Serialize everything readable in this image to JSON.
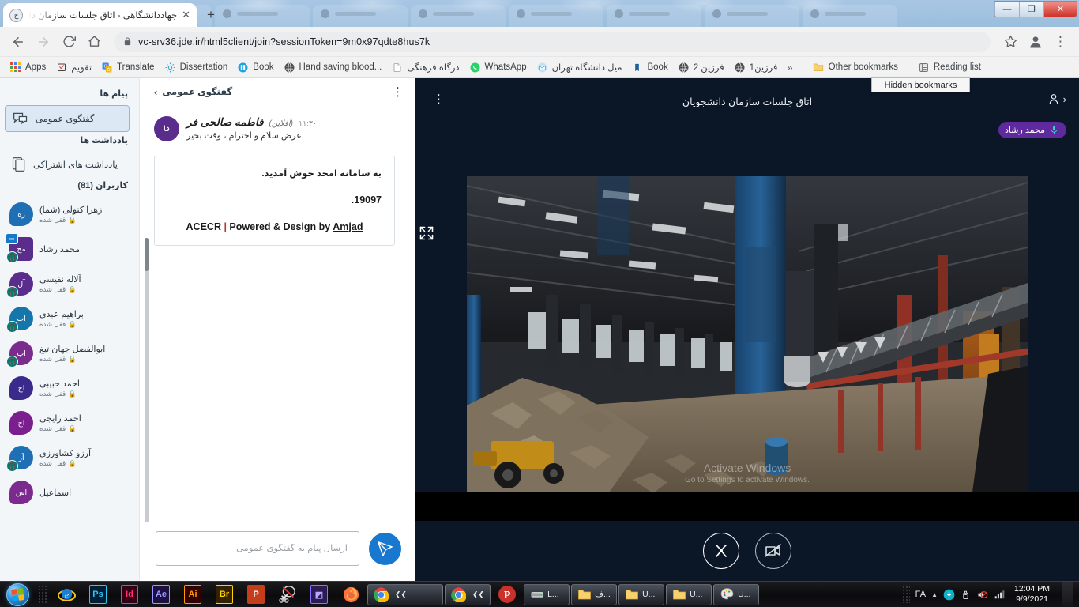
{
  "browser": {
    "tab": {
      "title": "جهاددانشگاهی - اتاق جلسات سازمان دانشج",
      "close_label": "✕",
      "favicon_label": "ج"
    },
    "new_tab_label": "+",
    "window_controls": {
      "minimize": "—",
      "maximize": "❐",
      "close": "✕"
    },
    "toolbar": {
      "back_label": "←",
      "forward_label": "→",
      "reload_label": "⟳",
      "home_label": "⌂",
      "lock_label": "🔒",
      "url_host": "vc-srv36.jde.ir",
      "url_path": "/html5client/join?sessionToken=9m0x97qdte8hus7k",
      "url_full": "vc-srv36.jde.ir/html5client/join?sessionToken=9m0x97qdte8hus7k",
      "star_label": "☆",
      "profile_label": "profile",
      "menu_label": "⋮"
    },
    "bookmarks": [
      {
        "label": "Apps",
        "icon": "apps-grid-icon"
      },
      {
        "label": "تقویم",
        "icon": "calendar-check-icon",
        "rtl": true
      },
      {
        "label": "Translate",
        "icon": "google-translate-icon"
      },
      {
        "label": "Dissertation",
        "icon": "gear-icon"
      },
      {
        "label": "Book",
        "icon": "book-globe-icon"
      },
      {
        "label": "Hand saving blood...",
        "icon": "globe-icon"
      },
      {
        "label": "درگاه فرهنگی",
        "icon": "document-icon",
        "rtl": true
      },
      {
        "label": "WhatsApp",
        "icon": "whatsapp-icon"
      },
      {
        "label": "میل دانشگاه تهران",
        "icon": "mail-icon",
        "rtl": true
      },
      {
        "label": "Book",
        "icon": "book-icon"
      },
      {
        "label": "فرزین 2",
        "icon": "globe-icon",
        "rtl": true
      },
      {
        "label": "فرزین1",
        "icon": "globe-icon",
        "rtl": true
      }
    ],
    "overflow_label": "»",
    "other_bookmarks": "Other bookmarks",
    "reading_list": "Reading list",
    "tooltip": "Hidden bookmarks"
  },
  "meeting": {
    "menu_label": "⋮",
    "title": "اتاق جلسات سازمان دانشجویان",
    "user_icon_label": "user-icon",
    "collapse_label": "‹",
    "active_talker": {
      "name": "محمد رشاد",
      "mic_icon": "microphone-icon"
    },
    "expand_icon": "expand-icon",
    "watermark": {
      "line1": "Activate Windows",
      "line2": "Go to Settings to activate Windows."
    },
    "controls": [
      {
        "name": "camera-off-button",
        "icon": "camera-off-icon"
      },
      {
        "name": "screen-share-button",
        "icon": "screen-share-icon"
      }
    ]
  },
  "chat": {
    "menu_label": "⋮",
    "title": "گفتگوی عمومی",
    "back_label": "›",
    "message": {
      "avatar_initials": "فا",
      "author": "فاطمه صالحی فر",
      "offline": "(آفلاین)",
      "time": "۱۱:۳۰",
      "text": "عرض سلام و احترام ، وقت بخیر"
    },
    "welcome": {
      "line1": "به سامانه امجد خوش آمدید.",
      "line2": ".19097",
      "line3_prefix": "ACECR ",
      "line3_bar": "|",
      "line3_mid": " Powered & Design by ",
      "line3_link": "Amjad"
    },
    "input_placeholder": "ارسال پیام به گفتگوی عمومی",
    "input_value": "",
    "send_label": "send-icon"
  },
  "sidebar": {
    "messages_header": "پیام ها",
    "chat_item": {
      "label": "گفتگوی عمومی",
      "icon": "chat-bubbles-icon"
    },
    "notes_header": "یادداشت ها",
    "notes_item": {
      "label": "یادداشت های اشتراکی",
      "icon": "notes-icon"
    },
    "users_header": "کاربران (81)",
    "users": [
      {
        "initials": "زه",
        "name": "زهرا کتولی (شما)",
        "status": "قفل شده",
        "color": "#1f6fb5",
        "shape": "round",
        "badge": "none"
      },
      {
        "initials": "مح",
        "name": "محمد رشاد",
        "status": "",
        "color": "#5a2d8c",
        "shape": "square",
        "badge": "screen"
      },
      {
        "initials": "آل",
        "name": "آلاله نفیسی",
        "status": "قفل شده",
        "color": "#5a2d8c",
        "shape": "round",
        "badge": "mic"
      },
      {
        "initials": "اب",
        "name": "ابراهیم عبدی",
        "status": "قفل شده",
        "color": "#1476aa",
        "shape": "round",
        "badge": "mic"
      },
      {
        "initials": "اب",
        "name": "ابوالفضل جهان تیغ",
        "status": "قفل شده",
        "color": "#7b2a8e",
        "shape": "round",
        "badge": "mic"
      },
      {
        "initials": "اح",
        "name": "احمد حبیبی",
        "status": "قفل شده",
        "color": "#3a2a8c",
        "shape": "round",
        "badge": "none"
      },
      {
        "initials": "اح",
        "name": "احمد رایجی",
        "status": "قفل شده",
        "color": "#7b1f8e",
        "shape": "round",
        "badge": "none"
      },
      {
        "initials": "آر",
        "name": "آرزو کشاورزی",
        "status": "قفل شده",
        "color": "#1f6fb5",
        "shape": "round",
        "badge": "mic"
      },
      {
        "initials": "اس",
        "name": "اسماعیل",
        "status": "",
        "color": "#7b2a8e",
        "shape": "round",
        "badge": "none"
      }
    ]
  },
  "taskbar": {
    "start_label": "start-orb",
    "pinned": [
      {
        "name": "internet-explorer",
        "label": "e",
        "color": "#1b7fd4",
        "bg": "transparent"
      },
      {
        "name": "photoshop",
        "label": "Ps",
        "color": "#31c5f0",
        "bg": "#001e36"
      },
      {
        "name": "indesign",
        "label": "Id",
        "color": "#ff3366",
        "bg": "#310016"
      },
      {
        "name": "after-effects",
        "label": "Ae",
        "color": "#9999ff",
        "bg": "#1d1040"
      },
      {
        "name": "illustrator",
        "label": "Ai",
        "color": "#ff9a00",
        "bg": "#330000"
      },
      {
        "name": "bridge",
        "label": "Br",
        "color": "#ffd400",
        "bg": "#332200"
      },
      {
        "name": "powerpoint",
        "label": "P",
        "color": "#ffffff",
        "bg": "#c43e1c"
      },
      {
        "name": "snipping-tool",
        "label": "✂",
        "color": "#ffffff",
        "bg": "transparent"
      },
      {
        "name": "ncp-tool",
        "label": "◩",
        "color": "#b9a6ff",
        "bg": "#2a1b52"
      },
      {
        "name": "firefox",
        "label": "🦊",
        "color": "#ff7139",
        "bg": "transparent"
      }
    ],
    "tasks": [
      {
        "name": "chrome-group",
        "label": "",
        "icon": "chrome-icon",
        "grouped": true
      },
      {
        "name": "chrome-window",
        "label": "",
        "icon": "chrome-icon",
        "grouped": false
      },
      {
        "name": "telegram",
        "label": "",
        "icon": "telegram-icon",
        "grouped": false
      },
      {
        "name": "drive",
        "label": "L...",
        "icon": "drive-icon",
        "grouped": false
      },
      {
        "name": "folder-1",
        "label": "ف...",
        "icon": "folder-icon",
        "grouped": false
      },
      {
        "name": "folder-2",
        "label": "U...",
        "icon": "folder-icon",
        "grouped": false
      },
      {
        "name": "folder-3",
        "label": "U...",
        "icon": "folder-icon",
        "grouped": false
      },
      {
        "name": "paint",
        "label": "U...",
        "icon": "paint-icon",
        "grouped": false
      }
    ],
    "tray": {
      "language": "FA",
      "chevron": "▲",
      "icons": [
        "update-icon",
        "usb-icon",
        "volume-muted-icon",
        "network-icon"
      ],
      "time": "12:04 PM",
      "date": "9/9/2021"
    }
  },
  "colors": {
    "accent_blue": "#1878cf",
    "purple": "#5e2a9e",
    "meeting_bg": "#0b1626",
    "sidebar_bg": "#f3f6f9"
  }
}
